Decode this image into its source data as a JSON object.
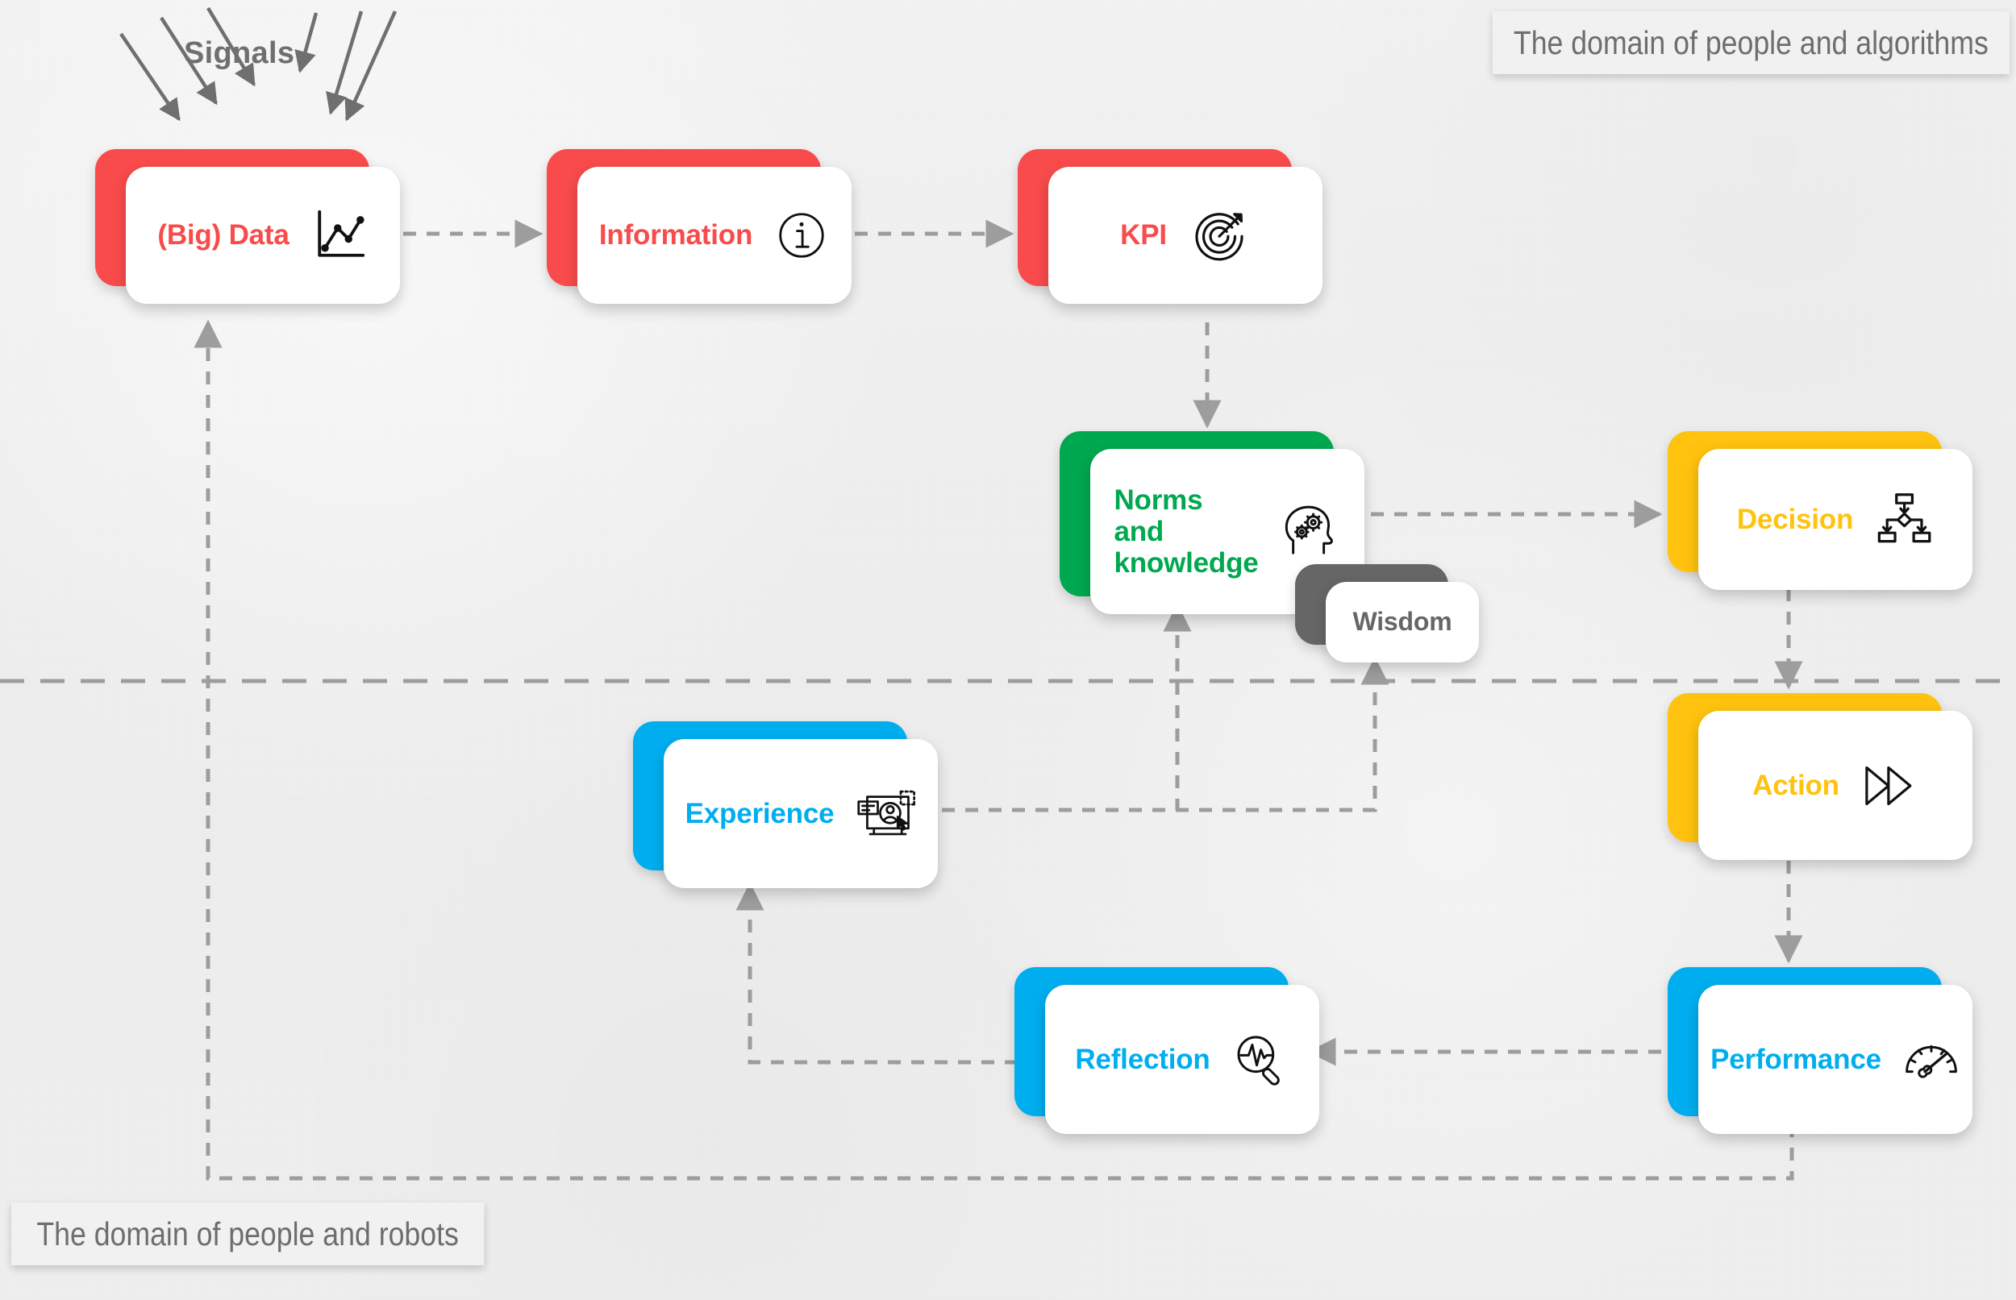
{
  "diagram": {
    "title": "Signals to Performance knowledge flow",
    "signals_label": "Signals",
    "banners": {
      "top": "The domain of people and algorithms",
      "bottom": "The domain of people and robots"
    },
    "colors": {
      "red": "#f94b4b",
      "green": "#00a84f",
      "yellow": "#ffc20e",
      "blue": "#00aeef",
      "gray": "#666666",
      "connector": "#9d9d9d",
      "divider": "#9d9d9d",
      "background": "#eeeeee",
      "banner_text": "#6d6d6d"
    },
    "nodes": {
      "data": {
        "label": "(Big) Data",
        "color": "#f94b4b",
        "icon": "line-chart-icon"
      },
      "information": {
        "label": "Information",
        "color": "#f94b4b",
        "icon": "info-circle-icon"
      },
      "kpi": {
        "label": "KPI",
        "color": "#f94b4b",
        "icon": "target-bullseye-icon"
      },
      "norms": {
        "label": "Norms and\nknowledge",
        "color": "#00a84f",
        "icon": "head-gears-icon"
      },
      "wisdom": {
        "label": "Wisdom",
        "color": "#666666",
        "icon": "none"
      },
      "decision": {
        "label": "Decision",
        "color": "#ffc20e",
        "icon": "flowchart-icon"
      },
      "action": {
        "label": "Action",
        "color": "#ffc20e",
        "icon": "fast-forward-icon"
      },
      "performance": {
        "label": "Performance",
        "color": "#00aeef",
        "icon": "gauge-speedometer-icon"
      },
      "reflection": {
        "label": "Reflection",
        "color": "#00aeef",
        "icon": "magnifier-pulse-icon"
      },
      "experience": {
        "label": "Experience",
        "color": "#00aeef",
        "icon": "monitor-user-cursor-icon"
      }
    },
    "edges": [
      {
        "from": "data",
        "to": "information",
        "style": "dashed"
      },
      {
        "from": "information",
        "to": "kpi",
        "style": "dashed"
      },
      {
        "from": "kpi",
        "to": "norms",
        "style": "dashed"
      },
      {
        "from": "norms",
        "to": "decision",
        "style": "dashed"
      },
      {
        "from": "decision",
        "to": "action",
        "style": "dashed"
      },
      {
        "from": "action",
        "to": "performance",
        "style": "dashed"
      },
      {
        "from": "performance",
        "to": "reflection",
        "style": "dashed"
      },
      {
        "from": "performance",
        "to": "data",
        "style": "dashed"
      },
      {
        "from": "reflection",
        "to": "experience",
        "style": "dashed"
      },
      {
        "from": "experience",
        "to": "norms",
        "style": "dashed"
      },
      {
        "from": "experience",
        "to": "wisdom",
        "style": "dashed"
      }
    ]
  }
}
